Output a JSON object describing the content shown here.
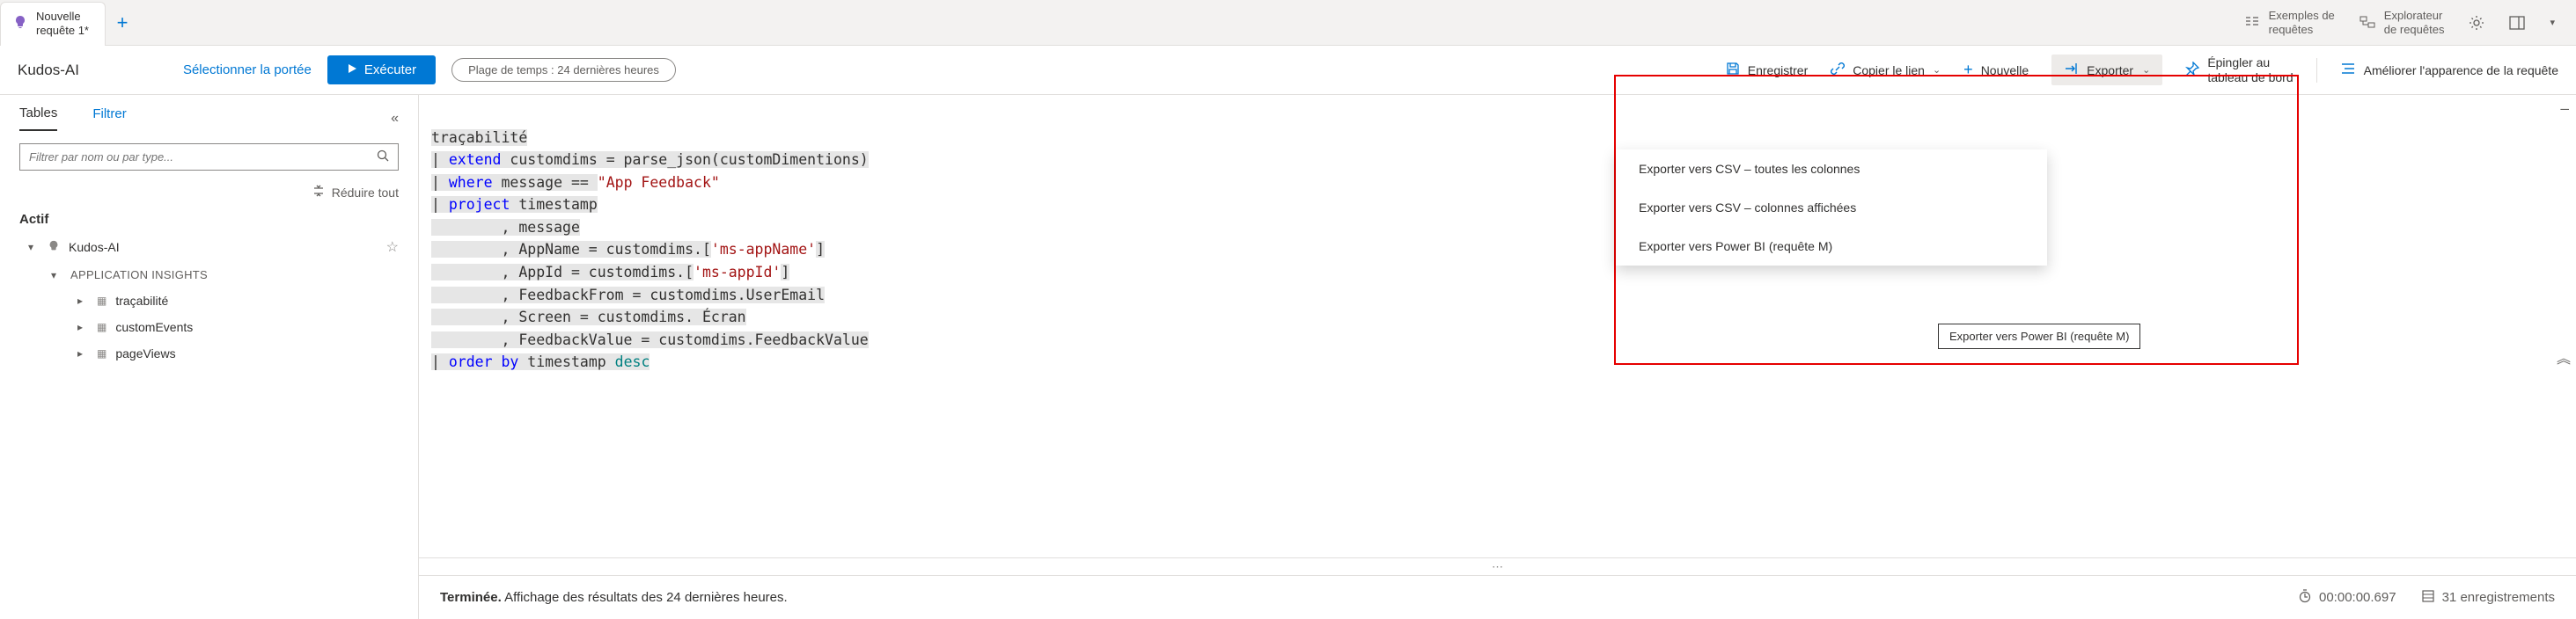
{
  "tab": {
    "title": "Nouvelle\nrequête 1*"
  },
  "header": {
    "examples": "Exemples de\nrequêtes",
    "explorer": "Explorateur\nde requêtes"
  },
  "toolbar": {
    "scope": "Kudos-AI",
    "select_scope": "Sélectionner la portée",
    "run": "Exécuter",
    "time_range": "Plage de temps : 24 dernières heures",
    "save": "Enregistrer",
    "copy_link": "Copier le lien",
    "new_rule": "Nouvelle",
    "export": "Exporter",
    "pin": "Épingler au\ntableau de bord",
    "improve": "Améliorer l'apparence de la requête"
  },
  "left": {
    "tab_tables": "Tables",
    "tab_filter": "Filtrer",
    "filter_placeholder": "Filtrer par nom ou par type...",
    "reduce_all": "Réduire tout",
    "group_active": "Actif",
    "node_root": "Kudos-AI",
    "node_insights": "APPLICATION INSIGHTS",
    "node_a": "traçabilité",
    "node_b": "customEvents",
    "node_c": "pageViews"
  },
  "query": {
    "l1": "traçabilité",
    "l2a": "| ",
    "l2b": "extend",
    "l2c": " customdims = parse_json(customDimentions)",
    "l3a": "| ",
    "l3b": "where",
    "l3c": " message == ",
    "l3d": "\"App Feedback\"",
    "l4a": "| ",
    "l4b": "project",
    "l4c": " timestamp",
    "l5": "        , message",
    "l6a": "        , AppName = customdims.[",
    "l6b": "'ms-appName'",
    "l6c": "]",
    "l7a": "        , AppId = customdims.[",
    "l7b": "'ms-appId'",
    "l7c": "]",
    "l8": "        , FeedbackFrom = customdims.UserEmail",
    "l9": "        , Screen = customdims. Écran",
    "l10": "        , FeedbackValue = customdims.FeedbackValue",
    "l11a": "| ",
    "l11b": "order by",
    "l11c": " timestamp ",
    "l11d": "desc"
  },
  "export_menu": {
    "item1": "Exporter vers CSV – toutes les colonnes",
    "item2": "Exporter vers CSV – colonnes affichées",
    "item3": "Exporter vers Power BI (requête M)",
    "tooltip": "Exporter vers Power BI (requête M)"
  },
  "status": {
    "done": "Terminée.",
    "msg": "Affichage des résultats des 24 dernières heures.",
    "duration": "00:00:00.697",
    "records": "31 enregistrements"
  }
}
